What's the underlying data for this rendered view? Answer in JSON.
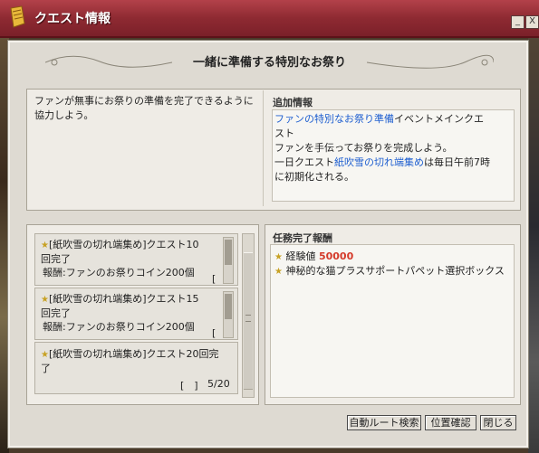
{
  "window": {
    "title": "クエスト情報",
    "minimize_label": "_",
    "close_label": "X"
  },
  "header": {
    "title": "一緒に準備する特別なお祭り"
  },
  "description": "ファンが無事にお祭りの準備を完了できるように協力しよう。",
  "additional_info": {
    "heading": "追加情報",
    "line1_blue": "ファンの特別なお祭り準備",
    "line1_rest": "イベントメインクエ",
    "line2": "スト",
    "line3": "ファンを手伝ってお祭りを完成しよう。",
    "line4_prefix": "一日クエスト",
    "line4_blue": "紙吹雪の切れ端集め",
    "line4_suffix": "は毎日午前7時",
    "line5": "に初期化される。"
  },
  "quests": [
    {
      "line1": "[紙吹雪の切れ端集め]クエスト10",
      "line2": "回完了",
      "reward": "報酬:ファンのお祭りコイン200個",
      "box": "[　]"
    },
    {
      "line1": "[紙吹雪の切れ端集め]クエスト15",
      "line2": "回完了",
      "reward": "報酬:ファンのお祭りコイン200個",
      "box": "[　]"
    },
    {
      "line1": "[紙吹雪の切れ端集め]クエスト20回完",
      "line2": "了",
      "box": "[　]",
      "progress": "5/20"
    }
  ],
  "rewards": {
    "heading": "任務完了報酬",
    "exp_label": "経験値",
    "exp_value": "50000",
    "item": "神秘的な猫プラスサポートパペット選択ボックス"
  },
  "buttons": {
    "auto_route": "自動ルート検索",
    "locate": "位置確認",
    "close": "閉じる"
  },
  "colors": {
    "title_bar": "#8e2a32",
    "highlight_blue": "#1f5fd0",
    "exp_red": "#d43a2a"
  }
}
